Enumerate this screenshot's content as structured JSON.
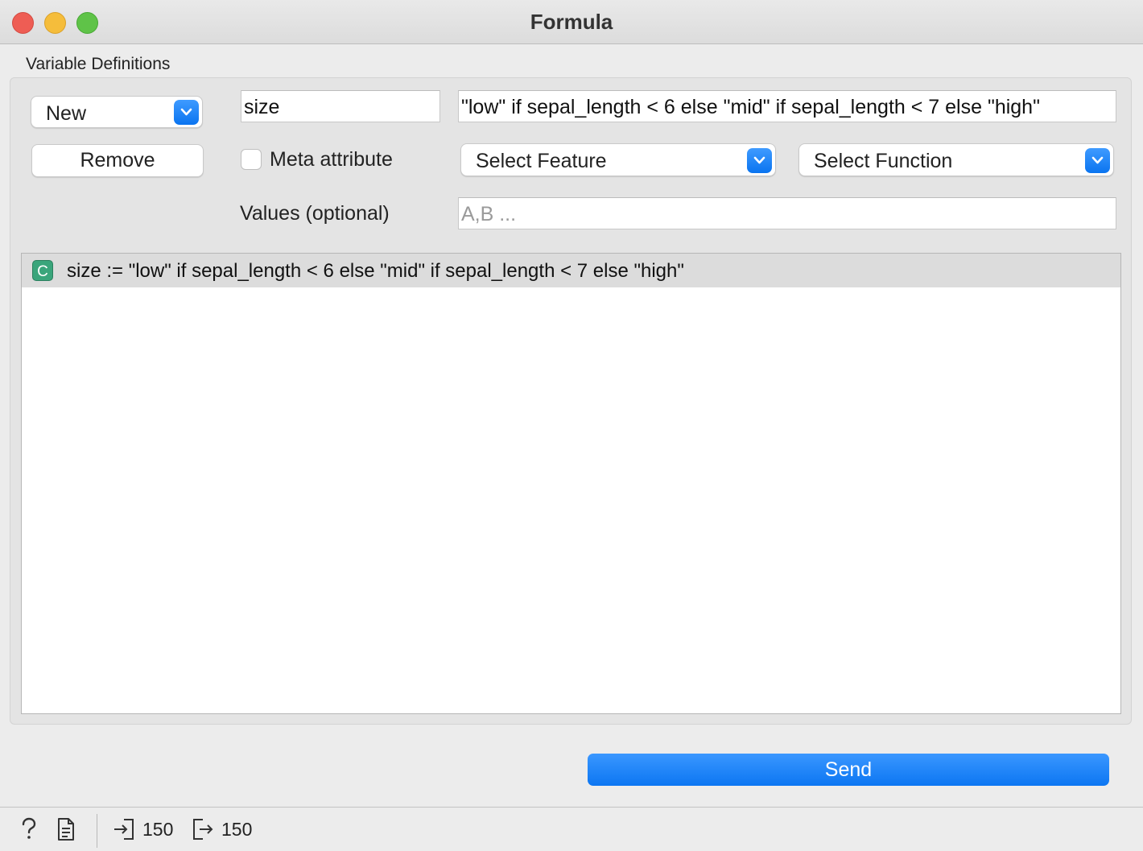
{
  "window": {
    "title": "Formula"
  },
  "group": {
    "label": "Variable Definitions"
  },
  "controls": {
    "new_combo": "New",
    "remove_button": "Remove",
    "name_value": "size",
    "expression_value": "\"low\" if sepal_length < 6 else \"mid\" if sepal_length < 7 else \"high\"",
    "meta_checkbox": {
      "label": "Meta attribute",
      "checked": false
    },
    "feature_combo": "Select Feature",
    "function_combo": "Select Function",
    "values_label": "Values (optional)",
    "values_placeholder": "A,B ..."
  },
  "list": {
    "items": [
      {
        "icon": "categorical-c-icon",
        "badge": "C",
        "text": "size := \"low\" if sepal_length < 6 else \"mid\" if sepal_length < 7 else \"high\""
      }
    ]
  },
  "send_button": "Send",
  "status": {
    "input_count": "150",
    "output_count": "150"
  },
  "colors": {
    "accent": "#0a74f0",
    "categorical_badge": "#3aa57b"
  }
}
